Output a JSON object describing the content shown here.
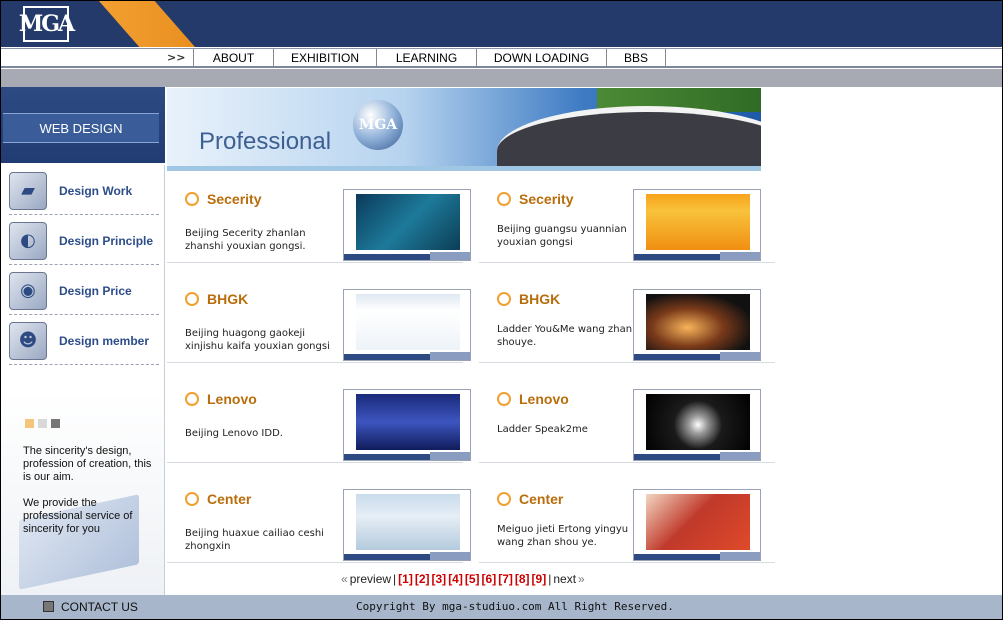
{
  "header": {
    "logo_text": "MGA",
    "nav_arrow": ">>",
    "nav_items": [
      "ABOUT",
      "EXHIBITION",
      "LEARNING",
      "DOWN LOADING",
      "BBS"
    ]
  },
  "sidebar": {
    "section_title": "WEB DESIGN",
    "items": [
      {
        "label": "Design Work",
        "icon": "picture-frame-icon"
      },
      {
        "label": "Design Principle",
        "icon": "compass-icon"
      },
      {
        "label": "Design Price",
        "icon": "price-icon"
      },
      {
        "label": "Design member",
        "icon": "people-icon"
      }
    ],
    "text1": "The sincerity's design, profession of creation, this is our aim.",
    "text2": "We provide the professional service of sincerity for you"
  },
  "banner": {
    "title": "Professional",
    "logo_text": "MGA"
  },
  "cards": [
    {
      "title": "Secerity",
      "desc": "Beijing Secerity zhanlan zhanshi youxian gongsi."
    },
    {
      "title": "Secerity",
      "desc": "Beijing guangsu yuannian youxian gongsi"
    },
    {
      "title": "BHGK",
      "desc": "Beijing huagong gaokeji xinjishu kaifa youxian  gongsi"
    },
    {
      "title": "BHGK",
      "desc": "Ladder You&Me wang zhan shouye."
    },
    {
      "title": "Lenovo",
      "desc": "Beijing Lenovo IDD."
    },
    {
      "title": "Lenovo",
      "desc": "Ladder Speak2me"
    },
    {
      "title": "Center",
      "desc": "Beijing huaxue cailiao ceshi zhongxin"
    },
    {
      "title": "Center",
      "desc": "Meiguo jieti Ertong yingyu wang zhan shou ye."
    }
  ],
  "pager": {
    "prev": "preview",
    "pages": [
      "[1]",
      "[2]",
      "[3]",
      "[4]",
      "[5]",
      "[6]",
      "[7]",
      "[8]",
      "[9]"
    ],
    "next": "next"
  },
  "footer": {
    "contact": "CONTACT US",
    "copyright": "Copyright By mga-studiuo.com All Right Reserved."
  },
  "colors": {
    "header_bg": "#243a6a",
    "accent_orange": "#f2a031",
    "title_orange": "#b86e0c",
    "pager_red": "#cc0000"
  }
}
